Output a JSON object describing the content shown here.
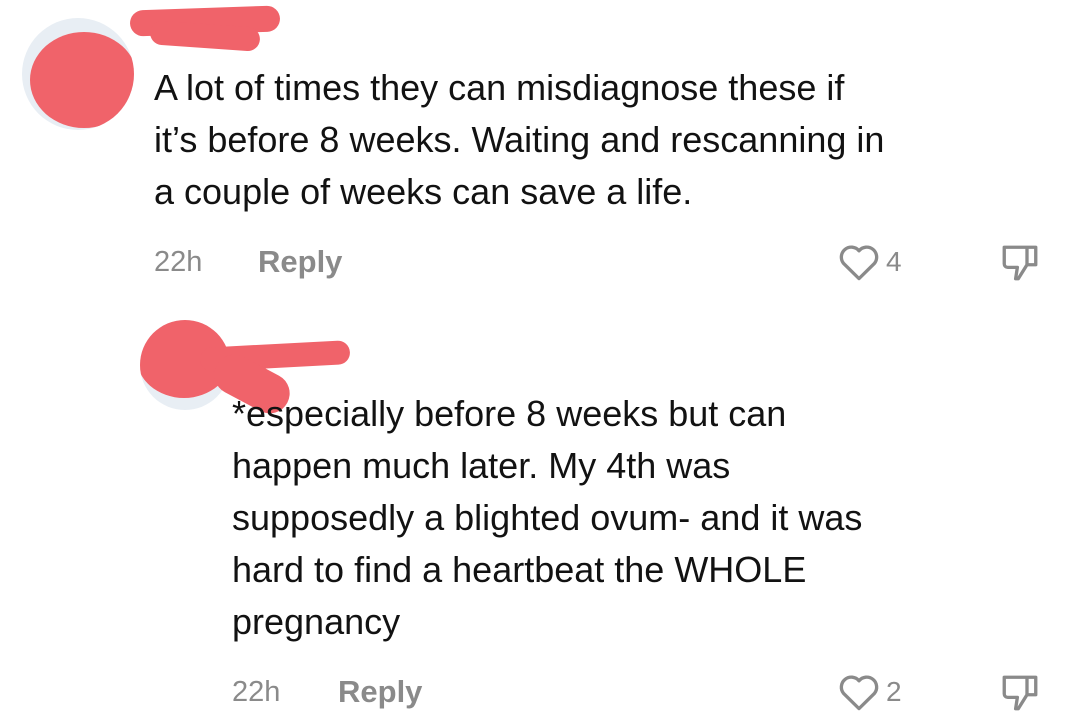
{
  "comments": [
    {
      "text": "A lot of times they can misdiagnose these if\nit’s before 8 weeks. Waiting and rescanning in\na couple of weeks can save a life.",
      "time": "22h",
      "reply_label": "Reply",
      "likes": "4"
    },
    {
      "text": "*especially before 8 weeks but can\nhappen much later. My 4th was\nsupposedly a blighted ovum- and it was\nhard to find a heartbeat the WHOLE\npregnancy",
      "time": "22h",
      "reply_label": "Reply",
      "likes": "2"
    }
  ],
  "colors": {
    "redaction": "#f0636a",
    "meta_gray": "#8a8a8a",
    "text": "#121212"
  },
  "icons": {
    "like": "heart-outline-icon",
    "dislike": "thumbs-down-outline-icon"
  }
}
